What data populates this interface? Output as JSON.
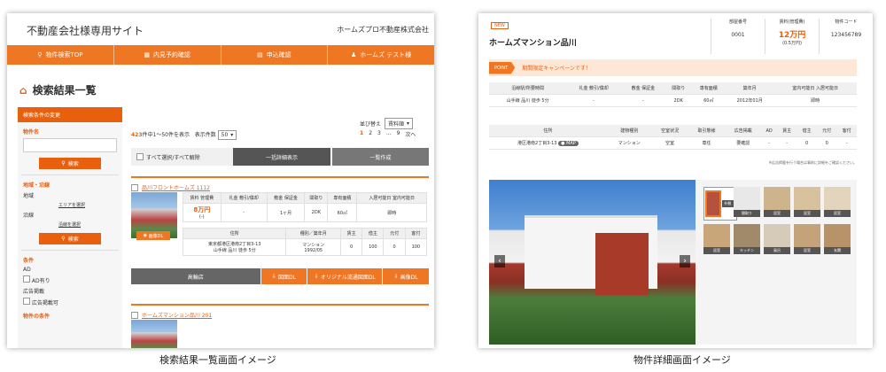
{
  "left_panel": {
    "header_title": "不動産会社様専用サイト",
    "company": "ホームズプロ不動産株式会社",
    "nav": [
      "物件検索TOP",
      "内見予約確認",
      "申込確認",
      "ホームズ テスト様"
    ],
    "page_title": "検索結果一覧",
    "sidebar": {
      "header": "検索条件の変更",
      "property_name_label": "物件名",
      "search_button": "検索",
      "area_label": "地域・沿線",
      "region_label": "地域",
      "area_link": "エリアを選択",
      "line_label": "沿線",
      "line_link": "沿線を選択",
      "conditions_label": "条件",
      "ad_label": "AD",
      "ad_option": "AD有り",
      "listing_label": "広告掲載",
      "listing_option": "広告掲載可",
      "property_cond_label": "物件の条件"
    },
    "results": {
      "total": "423",
      "range_text": "件中1～50件を表示",
      "per_page_label": "表示件数",
      "per_page": "50",
      "sort_label": "並び替え",
      "sort_value": "賃料順",
      "pages": [
        "1",
        "2",
        "3",
        "...",
        "9",
        "次へ"
      ],
      "select_all": "すべて選択/すべて解除",
      "bulk_detail": "一括詳細表示",
      "bulk_create": "一覧作成"
    },
    "property1": {
      "name": "品川フロントホームズ 1112",
      "photo_btn": "画像DL",
      "headers": [
        "賃料\n管理費",
        "礼金\n敷引/償却",
        "敷金\n保証金",
        "間取り",
        "専有面積",
        "入居可能日\n室内可能日"
      ],
      "price": "8万円",
      "mgmt": "(-)",
      "key_money": "-",
      "deposit": "1ヶ月",
      "layout": "2DK",
      "area": "60㎡",
      "move_in": "即時",
      "addr_header": "住所",
      "type_header": "種別／築年月",
      "fee_headers": [
        "賃主",
        "借主",
        "元付",
        "客付"
      ],
      "address": "東京都港区港南2丁目3-13",
      "station": "山手線 品川 徒歩 5分",
      "bldg_type": "マンション",
      "built": "1992/05",
      "fees": [
        "0",
        "100",
        "0",
        "100"
      ],
      "btn_ad": "高輪店",
      "btn_fig": "図面DL",
      "btn_orig": "オリジナル流通図面DL",
      "btn_photo": "画像DL"
    },
    "property2": {
      "name": "ホームズマンション品川 201"
    },
    "caption": "検索結果一覧画面イメージ"
  },
  "right_panel": {
    "new_badge": "NEW",
    "title": "ホームズマンション品川",
    "room_label": "部屋番号",
    "room_value": "0001",
    "rent_label": "賃料(管理費)",
    "rent_value": "12万円",
    "rent_sub": "(0.5万円)",
    "code_label": "物件コード",
    "code_value": "123456789",
    "point_tag": "POINT",
    "point_text": "期間限定キャンペーンです！",
    "table_headers": [
      "沿線駅/所要時間",
      "礼金\n敷引/償却",
      "敷金\n保証金",
      "間取り",
      "専有面積",
      "築年月",
      "室内可能日\n入居可能日"
    ],
    "row1": [
      "山手線 品川 徒歩 5分",
      "-",
      "-",
      "2DK",
      "60㎡",
      "2012年01月",
      "即時"
    ],
    "table_headers2": [
      "住所",
      "建物種別",
      "空室状況",
      "取引態様",
      "広告掲載",
      "AD",
      "賃主",
      "借主",
      "元付",
      "客付"
    ],
    "row2": [
      "港区港南2丁目3-13",
      "マンション",
      "空室",
      "専任",
      "要確認",
      "-",
      "-",
      "0",
      "0",
      "-"
    ],
    "map_btn": "MAP",
    "note": "※広告掲載を行う場合は事前に詳細をご確認ください。",
    "thumbs": [
      "外観",
      "間取り",
      "居室",
      "居室",
      "居室",
      "居室",
      "キッチン",
      "風呂",
      "居室",
      "玄関"
    ],
    "caption": "物件詳細画面イメージ"
  }
}
